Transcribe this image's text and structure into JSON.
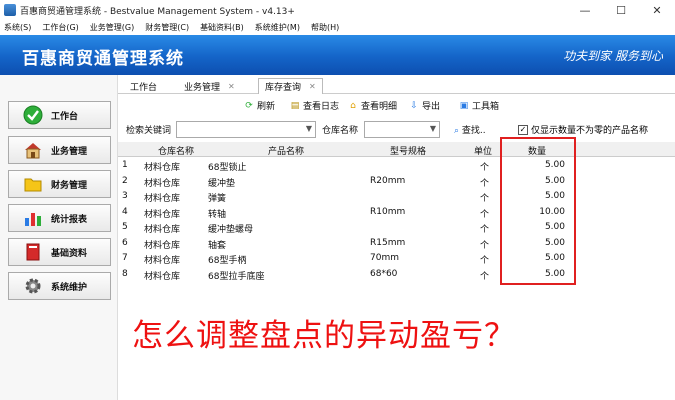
{
  "window": {
    "title": "百惠商贸通管理系统 - Bestvalue Management System - v4.13+",
    "controls": [
      "—",
      "☐",
      "✕"
    ]
  },
  "menu": [
    "系统(S)",
    "工作台(G)",
    "业务管理(G)",
    "财务管理(C)",
    "基础资料(B)",
    "系统维护(M)",
    "帮助(H)"
  ],
  "banner": {
    "app_name": "百惠商贸通管理系统",
    "slogan": "功夫到家  服务到心"
  },
  "sidebar": {
    "items": [
      {
        "label": "工作台",
        "icon": "check-circle-icon"
      },
      {
        "label": "业务管理",
        "icon": "house-icon"
      },
      {
        "label": "财务管理",
        "icon": "folder-icon"
      },
      {
        "label": "统计报表",
        "icon": "bar-chart-icon"
      },
      {
        "label": "基础资料",
        "icon": "book-icon"
      },
      {
        "label": "系统维护",
        "icon": "gear-icon"
      }
    ]
  },
  "tabs": [
    {
      "label": "工作台",
      "closable": false
    },
    {
      "label": "业务管理",
      "closable": true
    },
    {
      "label": "库存查询",
      "closable": true,
      "active": true
    }
  ],
  "toolbar": {
    "refresh": "刷新",
    "view_log": "查看日志",
    "view_detail": "查看明细",
    "export": "导出",
    "toolbox": "工具箱"
  },
  "filter": {
    "keyword_label": "检索关键词",
    "warehouse_label": "仓库名称",
    "search_button": "查找..",
    "only_nonzero_label": "仅显示数量不为零的产品名称",
    "only_nonzero_checked": true
  },
  "grid": {
    "columns": [
      "仓库名称",
      "产品名称",
      "型号规格",
      "单位",
      "数量"
    ],
    "rows": [
      {
        "no": "1",
        "warehouse": "材料仓库",
        "product": "68型锁止",
        "spec": "",
        "unit": "个",
        "qty": "5.00"
      },
      {
        "no": "2",
        "warehouse": "材料仓库",
        "product": "缓冲垫",
        "spec": "R20mm",
        "unit": "个",
        "qty": "5.00"
      },
      {
        "no": "3",
        "warehouse": "材料仓库",
        "product": "弹簧",
        "spec": "",
        "unit": "个",
        "qty": "5.00"
      },
      {
        "no": "4",
        "warehouse": "材料仓库",
        "product": "转轴",
        "spec": "R10mm",
        "unit": "个",
        "qty": "10.00"
      },
      {
        "no": "5",
        "warehouse": "材料仓库",
        "product": "缓冲垫螺母",
        "spec": "",
        "unit": "个",
        "qty": "5.00"
      },
      {
        "no": "6",
        "warehouse": "材料仓库",
        "product": "轴套",
        "spec": "R15mm",
        "unit": "个",
        "qty": "5.00"
      },
      {
        "no": "7",
        "warehouse": "材料仓库",
        "product": "68型手柄",
        "spec": "70mm",
        "unit": "个",
        "qty": "5.00"
      },
      {
        "no": "8",
        "warehouse": "材料仓库",
        "product": "68型拉手底座",
        "spec": "68*60",
        "unit": "个",
        "qty": "5.00"
      }
    ]
  },
  "overlay_caption": "怎么调整盘点的异动盈亏？",
  "colors": {
    "banner": "#1464c8",
    "highlight": "#e02020",
    "caption": "#ee1111"
  }
}
